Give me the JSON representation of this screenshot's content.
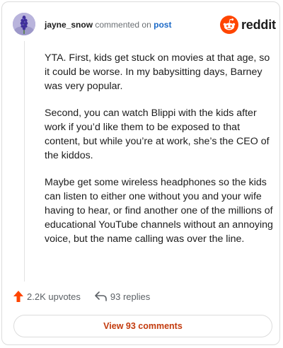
{
  "comment": {
    "username": "jayne_snow",
    "action_text": "commented on",
    "post_link": "post",
    "paragraphs": [
      "YTA. First, kids get stuck on movies at that age, so it could be worse. In my babysitting days, Barney was very popular.",
      "Second, you can watch Blippi with the kids after work if you’d like them to be exposed to that content, but while you’re at work, she’s the CEO of the kiddos.",
      "Maybe get some wireless headphones so the kids can listen to either one without you and your wife having to hear, or find another one of the millions of educational YouTube channels without an annoying voice, but the name calling was over the line."
    ]
  },
  "brand": {
    "wordmark": "reddit",
    "accent_color": "#ff4500"
  },
  "actions": {
    "upvotes": "2.2K upvotes",
    "replies": "93 replies"
  },
  "footer": {
    "view_button": "View 93 comments"
  },
  "icons": {
    "avatar": "lavender-flower-avatar",
    "logo": "reddit-snoo-icon",
    "upvote": "upvote-arrow-icon",
    "reply": "reply-arrow-icon"
  }
}
